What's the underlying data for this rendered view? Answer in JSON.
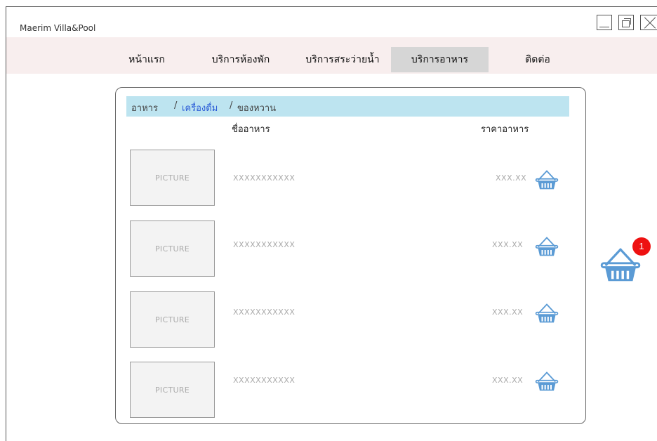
{
  "window": {
    "title": "Maerim Villa&Pool"
  },
  "nav": {
    "items": [
      {
        "label": "หน้าแรก",
        "active": false
      },
      {
        "label": "บริการห้องพัก",
        "active": false
      },
      {
        "label": "บริการสระว่ายน้ำ",
        "active": false
      },
      {
        "label": "บริการอาหาร",
        "active": true
      },
      {
        "label": "ติดต่อ",
        "active": false
      }
    ]
  },
  "breadcrumb": {
    "food": "อาหาร",
    "sep1": "/",
    "drinks": "เครื่องดื่ม",
    "sep2": "/",
    "desserts": "ของหวาน"
  },
  "table": {
    "headers": {
      "name": "ชื่ออาหาร",
      "price": "ราคาอาหาร"
    },
    "rows": [
      {
        "picture": "PICTURE",
        "name": "XXXXXXXXXXX",
        "price": "XXX.XX",
        "icon": "basket-icon"
      },
      {
        "picture": "PICTURE",
        "name": "XXXXXXXXXXX",
        "price": "XXX.XX",
        "icon": "basket-icon"
      },
      {
        "picture": "PICTURE",
        "name": "XXXXXXXXXXX",
        "price": "XXX.XX",
        "icon": "basket-icon"
      },
      {
        "picture": "PICTURE",
        "name": "XXXXXXXXXXX",
        "price": "XXX.XX",
        "icon": "basket-icon"
      }
    ]
  },
  "cart": {
    "icon": "cart-basket-icon",
    "count": "1"
  },
  "colors": {
    "nav_bg": "#f8eeee",
    "active_tab": "#d6d6d6",
    "breadcrumb_bg": "#bde4f0",
    "link": "#2a5bd7",
    "basket": "#5b9bd5",
    "badge": "#e11111"
  }
}
